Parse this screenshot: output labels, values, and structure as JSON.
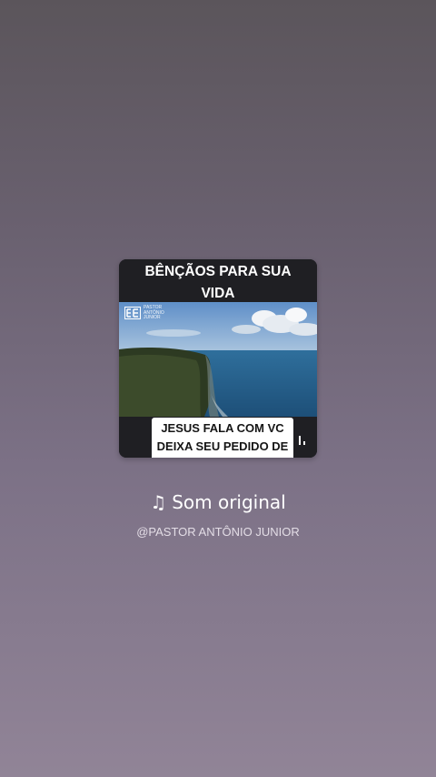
{
  "cover": {
    "title_line1": "BÊNÇÃOS PARA SUA",
    "title_line2": "VIDA",
    "logo_line1": "PASTOR",
    "logo_line2": "ANTÔNIO",
    "logo_line3": "JUNIOR",
    "caption_line1": "JESUS FALA COM VC",
    "caption_line2": "DEIXA SEU PEDIDO DE"
  },
  "sound": {
    "icon": "music-note-icon",
    "title": "Som original",
    "author": "@PASTOR ANTÔNIO JUNIOR"
  },
  "colors": {
    "text": "#ffffff",
    "card_bg": "#1f1f23",
    "caption_bg": "#ffffff"
  }
}
